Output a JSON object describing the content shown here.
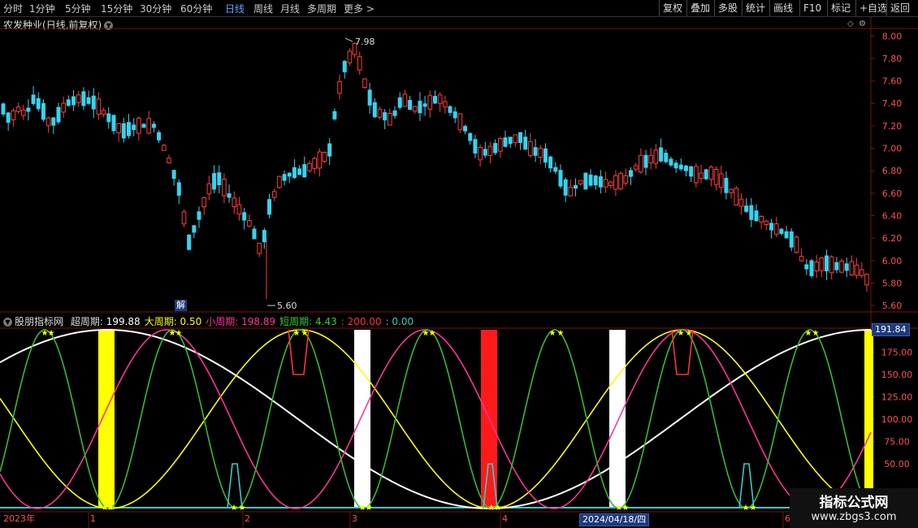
{
  "toolbar": {
    "periods": [
      {
        "label": "分时",
        "active": false
      },
      {
        "label": "1分钟",
        "active": false
      },
      {
        "label": "5分钟",
        "active": false
      },
      {
        "label": "15分钟",
        "active": false
      },
      {
        "label": "30分钟",
        "active": false
      },
      {
        "label": "60分钟",
        "active": false
      },
      {
        "label": "日线",
        "active": true
      },
      {
        "label": "周线",
        "active": false
      },
      {
        "label": "月线",
        "active": false
      },
      {
        "label": "多周期",
        "active": false
      },
      {
        "label": "更多",
        "active": false
      }
    ],
    "more_arrow": ">",
    "right_buttons": [
      "复权",
      "叠加",
      "多股",
      "统计",
      "画线",
      "F10",
      "标记",
      "+自选",
      "返回"
    ]
  },
  "chart_title": {
    "stock": "农发种业",
    "mode": "(日线,前复权)"
  },
  "price_axis": [
    "8.00",
    "7.80",
    "7.60",
    "7.40",
    "7.20",
    "7.00",
    "6.80",
    "6.60",
    "6.40",
    "6.20",
    "6.00",
    "5.80",
    "5.60"
  ],
  "price_annotations": {
    "high": "7.98",
    "low": "5.60"
  },
  "jie_label": "解",
  "indicator": {
    "name": "股朋指标网",
    "params": [
      {
        "label": "超周期:",
        "value": "199.88",
        "color": "#ffffff"
      },
      {
        "label": "大周期:",
        "value": "0.50",
        "color": "#ffff00"
      },
      {
        "label": "小周期:",
        "value": "198.89",
        "color": "#ff3399"
      },
      {
        "label": "短周期:",
        "value": "4.43",
        "color": "#33cc33"
      },
      {
        "label": ":",
        "value": "200.00",
        "color": "#ff3333"
      },
      {
        "label": ":",
        "value": "0.00",
        "color": "#33cccc"
      }
    ],
    "axis": [
      "175.00",
      "150.00",
      "125.00",
      "100.00",
      "75.00",
      "50.00"
    ],
    "current_value": "191.84"
  },
  "time_axis": {
    "year": "2023年",
    "months": [
      "1",
      "2",
      "3",
      "4",
      "5",
      "6"
    ],
    "cursor_date": "2024/04/18/四"
  },
  "colors": {
    "up": "#ff3b3b",
    "down": "#36d3ef",
    "grid": "#7a1010"
  },
  "watermark": {
    "line1": "指标公式网",
    "line2": "www.zbgs3.com"
  },
  "chart_data": {
    "type": "candlestick",
    "price_range": [
      5.55,
      8.06
    ],
    "indicator_range": [
      0,
      200
    ],
    "note_high": 7.98,
    "note_low": 5.6
  }
}
